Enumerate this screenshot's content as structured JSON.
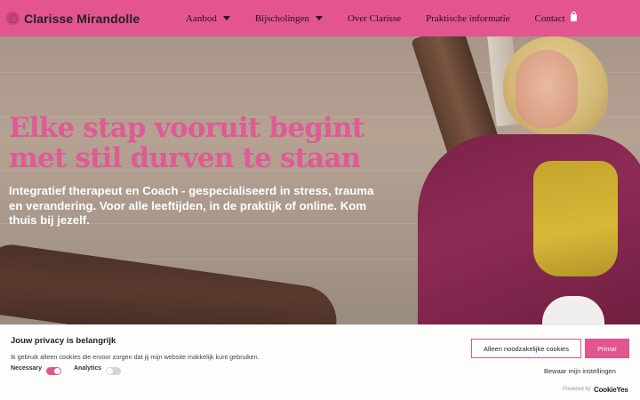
{
  "header": {
    "site_name": "Clarisse Mirandolle",
    "nav": [
      {
        "label": "Aanbod",
        "has_dropdown": true
      },
      {
        "label": "Bijscholingen",
        "has_dropdown": true
      },
      {
        "label": "Over Clarisse",
        "has_dropdown": false
      },
      {
        "label": "Praktische informatie",
        "has_dropdown": false
      },
      {
        "label": "Contact",
        "has_dropdown": false
      }
    ],
    "cart_icon": "shopping-bag-icon"
  },
  "hero": {
    "title": "Elke stap vooruit begint met stil durven te staan",
    "subtitle": "Integratief therapeut en Coach - gespecialiseerd in stress, trauma en verandering. Voor alle leeftijden, in de praktijk of online. Kom thuis bij jezelf."
  },
  "cookie_banner": {
    "title": "Jouw privacy is belangrijk",
    "text": "Ik gebruik alleen cookies die ervoor zorgen dat jij mijn website makkelijk kunt gebruiken.",
    "toggles": [
      {
        "label": "Necessary",
        "enabled": true
      },
      {
        "label": "Analytics",
        "enabled": false
      }
    ],
    "reject_label": "Alleen noodzakelijke cookies",
    "accept_label": "Prima!",
    "settings_label": "Bewaar mijn instellingen",
    "powered_by": "Powered by",
    "brand": "CookieYes"
  },
  "colors": {
    "accent": "#e2558e",
    "title_pink": "#e05a95"
  }
}
